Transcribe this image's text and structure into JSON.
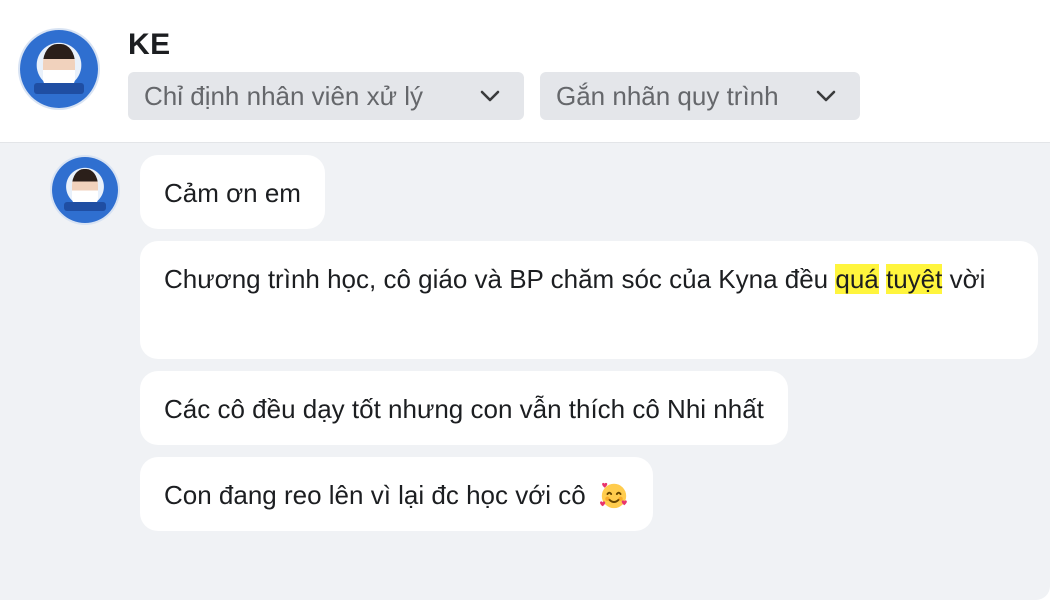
{
  "header": {
    "title": "KE",
    "assign_dropdown": "Chỉ định nhân viên xử lý",
    "label_dropdown": "Gắn nhãn quy trình"
  },
  "messages": [
    {
      "text": "Cảm ơn em"
    },
    {
      "parts": [
        "Chương trình học, cô giáo và BP chăm sóc của Kyna đều ",
        "quá",
        " ",
        "tuyệt",
        " vời"
      ]
    },
    {
      "text": "Các cô đều dạy tốt nhưng con vẫn thích cô Nhi nhất"
    },
    {
      "text": "Con đang reo lên vì lại đc học với cô"
    }
  ],
  "icons": {
    "header_avatar": "avatar",
    "chevron": "chevron-down-icon",
    "emoji": "smiling-face-with-hearts-icon"
  },
  "colors": {
    "chat_background": "#f0f2f5",
    "bubble": "#ffffff",
    "dropdown": "#e4e6ea",
    "highlight": "#fff53d"
  }
}
